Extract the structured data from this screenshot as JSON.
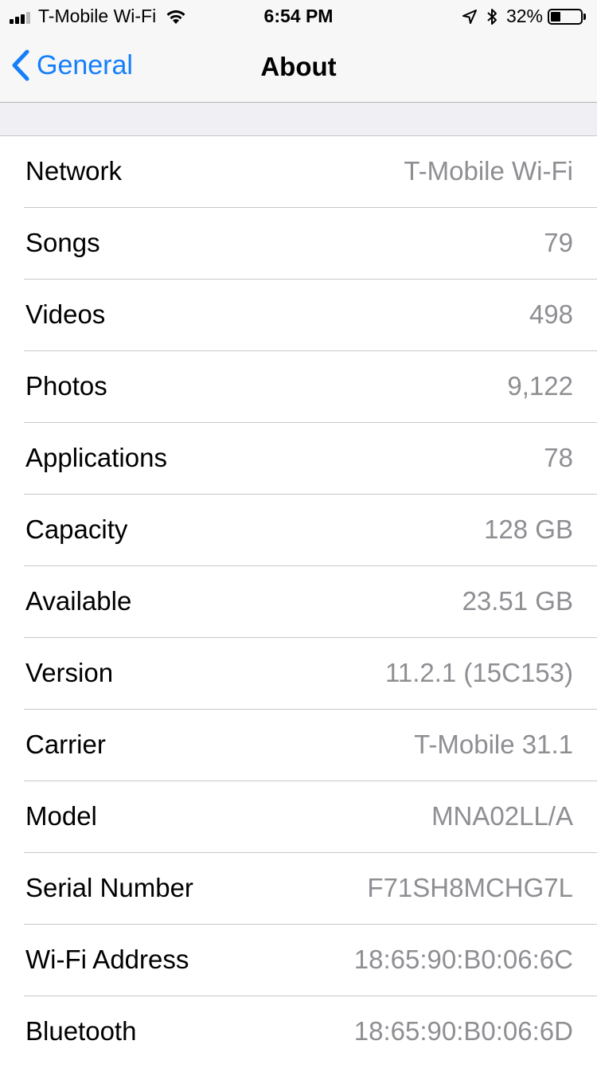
{
  "status_bar": {
    "carrier": "T-Mobile Wi-Fi",
    "time": "6:54 PM",
    "battery": "32%",
    "battery_level": 0.32,
    "icons": [
      "signal-icon",
      "wifi-icon",
      "location-arrow-icon",
      "bluetooth-icon",
      "battery-icon"
    ]
  },
  "nav": {
    "back_label": "General",
    "title": "About"
  },
  "colors": {
    "accent": "#157efb",
    "value_text": "#8e8e93",
    "group_background": "#efeff4",
    "separator": "#c8c7cc"
  },
  "rows": [
    {
      "label": "Network",
      "value": "T-Mobile Wi-Fi"
    },
    {
      "label": "Songs",
      "value": "79"
    },
    {
      "label": "Videos",
      "value": "498"
    },
    {
      "label": "Photos",
      "value": "9,122"
    },
    {
      "label": "Applications",
      "value": "78"
    },
    {
      "label": "Capacity",
      "value": "128 GB"
    },
    {
      "label": "Available",
      "value": "23.51 GB"
    },
    {
      "label": "Version",
      "value": "11.2.1 (15C153)"
    },
    {
      "label": "Carrier",
      "value": "T-Mobile 31.1"
    },
    {
      "label": "Model",
      "value": "MNA02LL/A"
    },
    {
      "label": "Serial Number",
      "value": "F71SH8MCHG7L"
    },
    {
      "label": "Wi-Fi Address",
      "value": "18:65:90:B0:06:6C"
    },
    {
      "label": "Bluetooth",
      "value": "18:65:90:B0:06:6D"
    }
  ]
}
